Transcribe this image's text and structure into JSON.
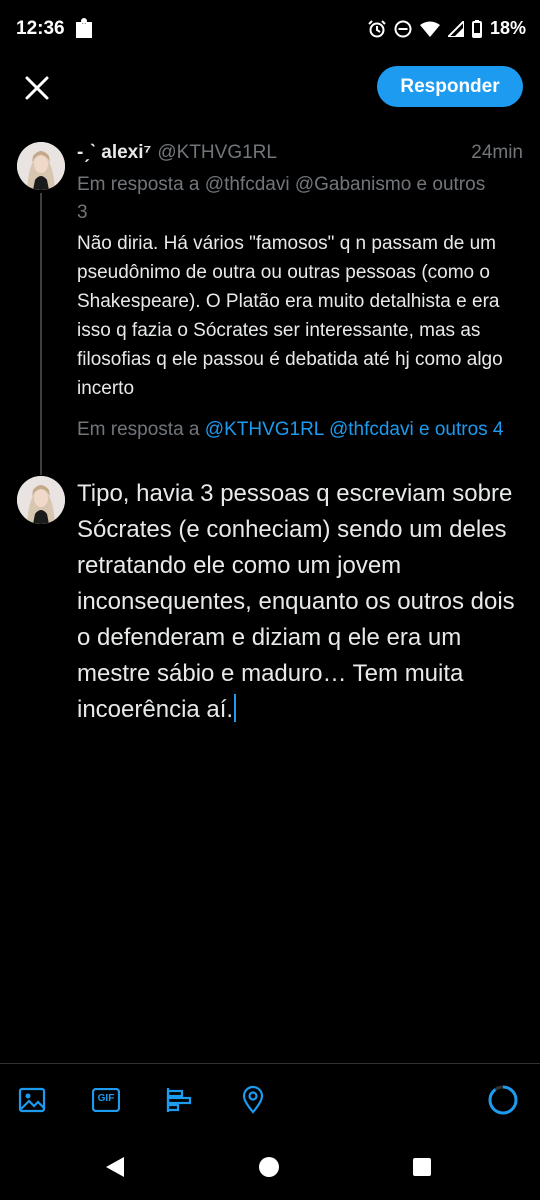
{
  "status_bar": {
    "time": "12:36",
    "battery": "18%"
  },
  "header": {
    "reply_button": "Responder"
  },
  "original_tweet": {
    "name": "-ˏˋ alexi⁷",
    "handle": "@KTHVG1RL",
    "time": "24min",
    "replying_to": "Em resposta a @thfcdavi @Gabanismo e outros 3",
    "text": "Não diria. Há vários \"famosos\" q n passam de um pseudônimo de outra ou outras pessoas (como o Shakespeare). O Platão era muito detalhista e era isso q fazia o Sócrates ser interessante, mas as filosofias q ele passou é debatida até hj como algo incerto"
  },
  "reply": {
    "replying_prefix": "Em resposta a",
    "replying_targets": "@KTHVG1RL @thfcdavi e outros 4",
    "text": "Tipo, havia 3 pessoas q escreviam sobre Sócrates (e conheciam) sendo um deles retratando ele como um jovem inconsequentes, enquanto os outros dois o defenderam e diziam q ele era um mestre sábio e maduro… Tem muita incoerência aí."
  },
  "toolbar": {
    "gif_label": "GIF",
    "accent_color": "#1d9bf0"
  },
  "icons": [
    "close-icon",
    "image-icon",
    "gif-icon",
    "poll-icon",
    "location-icon",
    "character-count-icon"
  ]
}
